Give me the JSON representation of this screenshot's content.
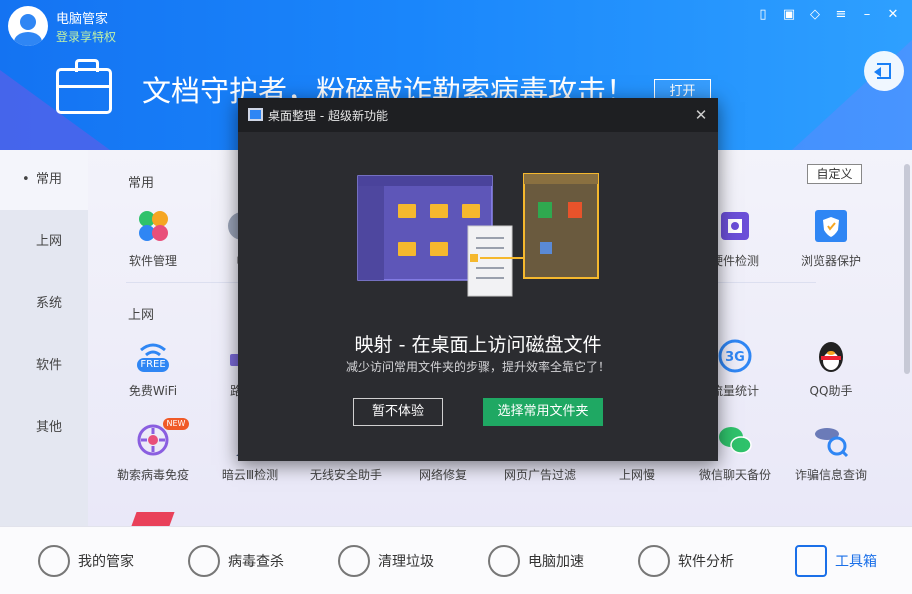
{
  "header": {
    "app_title": "电脑管家",
    "login_link": "登录享特权",
    "banner_text": "文档守护者，粉碎敲诈勒索病毒攻击！",
    "banner_button": "打开"
  },
  "sidebar": {
    "items": [
      {
        "label": "常用"
      },
      {
        "label": "上网"
      },
      {
        "label": "系统"
      },
      {
        "label": "软件"
      },
      {
        "label": "其他"
      }
    ]
  },
  "main": {
    "custom_button": "自定义",
    "sections": [
      {
        "title": "常用"
      },
      {
        "title": "上网"
      }
    ],
    "row1": [
      "软件管理",
      "电",
      "",
      "",
      "",
      "",
      "硬件检测",
      "浏览器保护"
    ],
    "row2": [
      "免费WiFi",
      "路由",
      "",
      "",
      "",
      "",
      "流量统计",
      "QQ助手"
    ],
    "row3": [
      "勒索病毒免疫",
      "暗云Ⅲ检测",
      "无线安全助手",
      "网络修复",
      "网页广告过滤",
      "上网慢",
      "微信聊天备份",
      "诈骗信息查询"
    ],
    "badges": {
      "free": "FREE",
      "new": "NEW",
      "g3": "3G"
    }
  },
  "bottom_nav": {
    "items": [
      {
        "label": "我的管家"
      },
      {
        "label": "病毒查杀"
      },
      {
        "label": "清理垃圾"
      },
      {
        "label": "电脑加速"
      },
      {
        "label": "软件分析"
      },
      {
        "label": "工具箱"
      }
    ]
  },
  "dialog": {
    "title": "桌面整理 - 超级新功能",
    "heading": "映射 - 在桌面上访问磁盘文件",
    "subtext": "减少访问常用文件夹的步骤，提升效率全靠它了！",
    "skip_button": "暂不体验",
    "choose_button": "选择常用文件夹"
  },
  "colors": {
    "header_blue": "#1a86fb",
    "accent_green": "#1fa863",
    "dialog_bg": "#2b2c30",
    "active_nav": "#1a6fe8"
  }
}
